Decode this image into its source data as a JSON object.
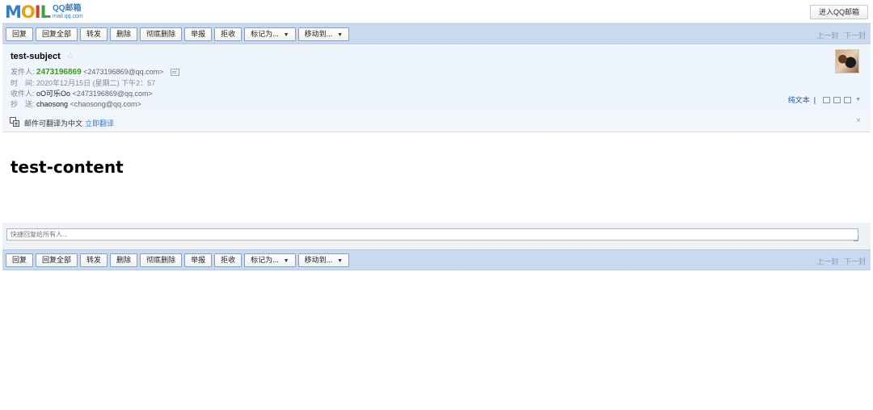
{
  "logo": {
    "brand": "MOIL",
    "cn": "QQ邮箱",
    "en": "mail.qq.com"
  },
  "header": {
    "enter_label": "进入QQ邮箱"
  },
  "toolbar": {
    "reply": "回复",
    "reply_all": "回复全部",
    "forward": "转发",
    "delete": "删除",
    "delete_permanently": "彻底删除",
    "report": "举报",
    "reject": "拒收",
    "mark_as": "标记为...",
    "move_to": "移动到...",
    "prev": "上一封",
    "next": "下一封"
  },
  "mail": {
    "subject": "test-subject",
    "from_label": "发件人:",
    "from_name": "2473196869",
    "from_addr": "<2473196869@qq.com>",
    "time_label": "时　间:",
    "time_value": "2020年12月15日 (星期二) 下午2：57",
    "to_label": "收件人:",
    "to_name": "oO可乐Oo",
    "to_addr": "<2473196869@qq.com>",
    "cc_label": "抄　送:",
    "cc_name": "chaosong",
    "cc_addr": "<chaosong@qq.com>",
    "plain_text": "纯文本",
    "body": "test-content"
  },
  "translate": {
    "text": "邮件可翻译为中文",
    "link": "立即翻译",
    "close": "×"
  },
  "quick_reply": {
    "placeholder": "快捷回复给所有人..."
  },
  "colors": {
    "toolbar_bg": "#c9daf0",
    "head_bg": "#eff5fc",
    "sender_green": "#3a9a17",
    "link_blue": "#2f7fd2"
  }
}
